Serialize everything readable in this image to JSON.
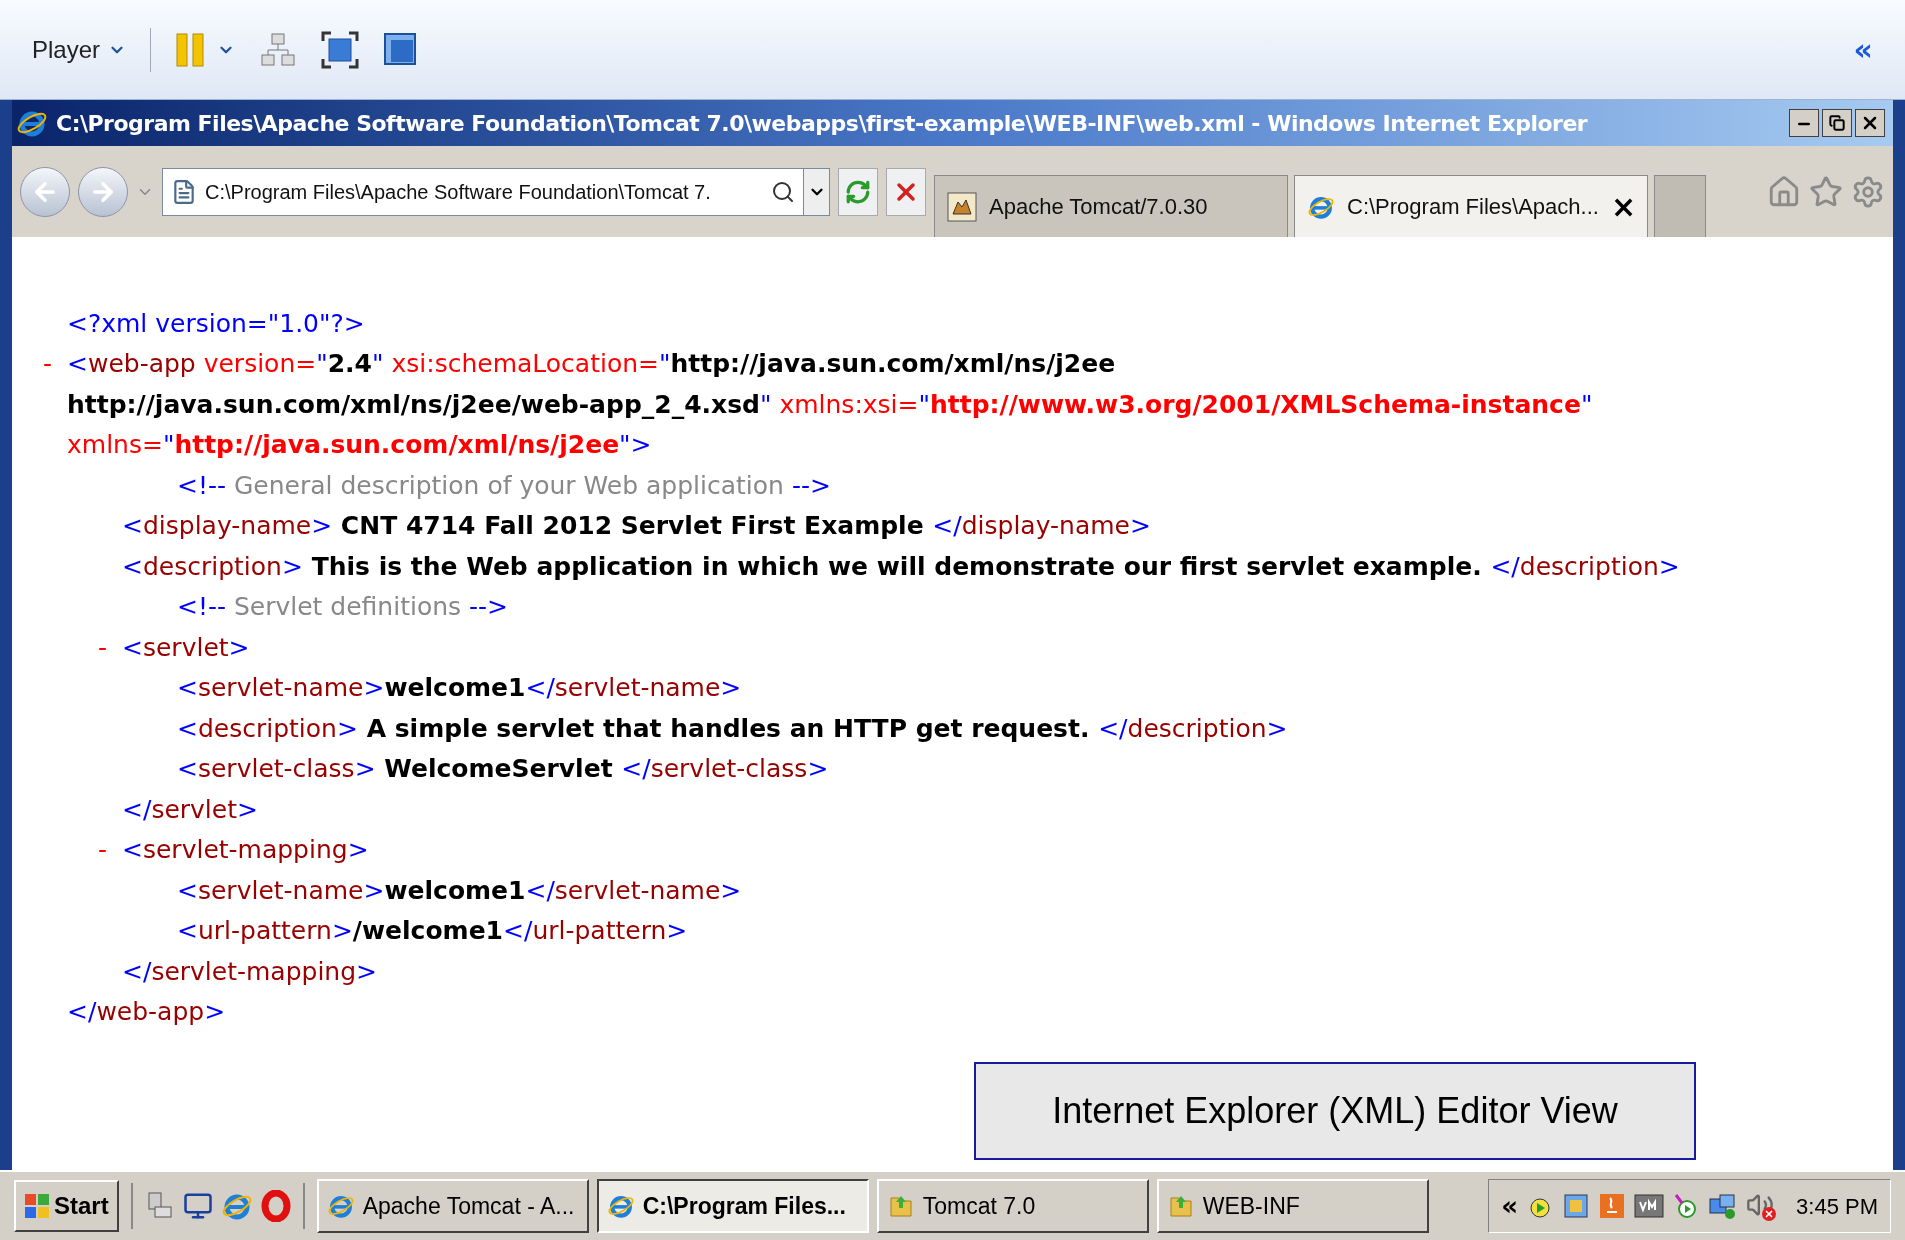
{
  "player": {
    "menu": "Player",
    "collapse": "«"
  },
  "window": {
    "title": "C:\\Program Files\\Apache Software Foundation\\Tomcat 7.0\\webapps\\first-example\\WEB-INF\\web.xml - Windows Internet Explorer"
  },
  "address": {
    "value": "C:\\Program Files\\Apache Software Foundation\\Tomcat 7."
  },
  "tabs": [
    {
      "label": "Apache Tomcat/7.0.30",
      "selected": false,
      "kind": "tomcat"
    },
    {
      "label": "C:\\Program Files\\Apach...",
      "selected": true,
      "kind": "ie",
      "close": "×"
    }
  ],
  "xml": [
    {
      "lines": [
        [
          {
            "kind": "punct",
            "text": "<?xml version=\"1.0\"?>"
          }
        ]
      ]
    },
    {
      "toggle": "-",
      "lines": [
        [
          {
            "kind": "punct",
            "text": "<"
          },
          {
            "kind": "tag",
            "text": "web-app"
          },
          {
            "kind": "attr",
            "text": " version="
          },
          {
            "kind": "punct",
            "text": "\""
          },
          {
            "kind": "value",
            "text": "2.4"
          },
          {
            "kind": "punct",
            "text": "\""
          },
          {
            "kind": "attr",
            "text": " xsi:schemaLocation="
          },
          {
            "kind": "punct",
            "text": "\""
          },
          {
            "kind": "value",
            "text": "http://java.sun.com/xml/ns/j2ee"
          }
        ],
        [
          {
            "kind": "value",
            "text": "http://java.sun.com/xml/ns/j2ee/web-app_2_4.xsd"
          },
          {
            "kind": "punct",
            "text": "\""
          },
          {
            "kind": "attr",
            "text": " xmlns:xsi="
          },
          {
            "kind": "punct",
            "text": "\""
          },
          {
            "kind": "link",
            "text": "http://www.w3.org/2001/XMLSchema-instance"
          },
          {
            "kind": "punct",
            "text": "\""
          }
        ],
        [
          {
            "kind": "attr",
            "text": "xmlns="
          },
          {
            "kind": "punct",
            "text": "\""
          },
          {
            "kind": "link",
            "text": "http://java.sun.com/xml/ns/j2ee"
          },
          {
            "kind": "punct",
            "text": "\">"
          }
        ]
      ],
      "children": [
        {
          "kind": "comment",
          "lines": [
            [
              {
                "kind": "punct",
                "text": "<!--"
              },
              {
                "kind": "comment",
                "text": " General description of your Web application "
              },
              {
                "kind": "punct",
                "text": "-->"
              }
            ]
          ]
        },
        {
          "lines": [
            [
              {
                "kind": "punct",
                "text": "<"
              },
              {
                "kind": "tag",
                "text": "display-name"
              },
              {
                "kind": "punct",
                "text": ">"
              },
              {
                "kind": "value",
                "text": " CNT 4714 Fall 2012 Servlet First Example "
              },
              {
                "kind": "punct",
                "text": "</"
              },
              {
                "kind": "tag",
                "text": "display-name"
              },
              {
                "kind": "punct",
                "text": ">"
              }
            ]
          ]
        },
        {
          "lines": [
            [
              {
                "kind": "punct",
                "text": "<"
              },
              {
                "kind": "tag",
                "text": "description"
              },
              {
                "kind": "punct",
                "text": ">"
              },
              {
                "kind": "value",
                "text": " This is the Web application in which we will demonstrate our first servlet example. "
              },
              {
                "kind": "punct",
                "text": "</"
              },
              {
                "kind": "tag",
                "text": "description"
              },
              {
                "kind": "punct",
                "text": ">"
              }
            ]
          ]
        },
        {
          "kind": "comment",
          "lines": [
            [
              {
                "kind": "punct",
                "text": "<!--"
              },
              {
                "kind": "comment",
                "text": " Servlet definitions "
              },
              {
                "kind": "punct",
                "text": "-->"
              }
            ]
          ]
        },
        {
          "toggle": "-",
          "lines": [
            [
              {
                "kind": "punct",
                "text": "<"
              },
              {
                "kind": "tag",
                "text": "servlet"
              },
              {
                "kind": "punct",
                "text": ">"
              }
            ]
          ],
          "children": [
            {
              "lines": [
                [
                  {
                    "kind": "punct",
                    "text": "<"
                  },
                  {
                    "kind": "tag",
                    "text": "servlet-name"
                  },
                  {
                    "kind": "punct",
                    "text": ">"
                  },
                  {
                    "kind": "value",
                    "text": "welcome1"
                  },
                  {
                    "kind": "punct",
                    "text": "</"
                  },
                  {
                    "kind": "tag",
                    "text": "servlet-name"
                  },
                  {
                    "kind": "punct",
                    "text": ">"
                  }
                ]
              ]
            },
            {
              "lines": [
                [
                  {
                    "kind": "punct",
                    "text": "<"
                  },
                  {
                    "kind": "tag",
                    "text": "description"
                  },
                  {
                    "kind": "punct",
                    "text": ">"
                  },
                  {
                    "kind": "value",
                    "text": " A simple servlet that handles an HTTP get request. "
                  },
                  {
                    "kind": "punct",
                    "text": "</"
                  },
                  {
                    "kind": "tag",
                    "text": "description"
                  },
                  {
                    "kind": "punct",
                    "text": ">"
                  }
                ]
              ]
            },
            {
              "lines": [
                [
                  {
                    "kind": "punct",
                    "text": "<"
                  },
                  {
                    "kind": "tag",
                    "text": "servlet-class"
                  },
                  {
                    "kind": "punct",
                    "text": ">"
                  },
                  {
                    "kind": "value",
                    "text": " WelcomeServlet "
                  },
                  {
                    "kind": "punct",
                    "text": "</"
                  },
                  {
                    "kind": "tag",
                    "text": "servlet-class"
                  },
                  {
                    "kind": "punct",
                    "text": ">"
                  }
                ]
              ]
            }
          ],
          "close": [
            {
              "kind": "punct",
              "text": "</"
            },
            {
              "kind": "tag",
              "text": "servlet"
            },
            {
              "kind": "punct",
              "text": ">"
            }
          ]
        },
        {
          "toggle": "-",
          "lines": [
            [
              {
                "kind": "punct",
                "text": "<"
              },
              {
                "kind": "tag",
                "text": "servlet-mapping"
              },
              {
                "kind": "punct",
                "text": ">"
              }
            ]
          ],
          "children": [
            {
              "lines": [
                [
                  {
                    "kind": "punct",
                    "text": "<"
                  },
                  {
                    "kind": "tag",
                    "text": "servlet-name"
                  },
                  {
                    "kind": "punct",
                    "text": ">"
                  },
                  {
                    "kind": "value",
                    "text": "welcome1"
                  },
                  {
                    "kind": "punct",
                    "text": "</"
                  },
                  {
                    "kind": "tag",
                    "text": "servlet-name"
                  },
                  {
                    "kind": "punct",
                    "text": ">"
                  }
                ]
              ]
            },
            {
              "lines": [
                [
                  {
                    "kind": "punct",
                    "text": "<"
                  },
                  {
                    "kind": "tag",
                    "text": "url-pattern"
                  },
                  {
                    "kind": "punct",
                    "text": ">"
                  },
                  {
                    "kind": "value",
                    "text": "/welcome1"
                  },
                  {
                    "kind": "punct",
                    "text": "</"
                  },
                  {
                    "kind": "tag",
                    "text": "url-pattern"
                  },
                  {
                    "kind": "punct",
                    "text": ">"
                  }
                ]
              ]
            }
          ],
          "close": [
            {
              "kind": "punct",
              "text": "</"
            },
            {
              "kind": "tag",
              "text": "servlet-mapping"
            },
            {
              "kind": "punct",
              "text": ">"
            }
          ]
        }
      ],
      "close": [
        {
          "kind": "punct",
          "text": "</"
        },
        {
          "kind": "tag",
          "text": "web-app"
        },
        {
          "kind": "punct",
          "text": ">"
        }
      ]
    }
  ],
  "caption": "Internet Explorer (XML) Editor View",
  "taskbar": {
    "start": "Start",
    "tasks": [
      {
        "label": "Apache Tomcat - A...",
        "selected": false,
        "kind": "ie"
      },
      {
        "label": "C:\\Program Files...",
        "selected": true,
        "kind": "ie"
      },
      {
        "label": "Tomcat 7.0",
        "selected": false,
        "kind": "folder"
      },
      {
        "label": "WEB-INF",
        "selected": false,
        "kind": "folder"
      }
    ],
    "tray_expand": "«",
    "clock": "3:45 PM"
  }
}
